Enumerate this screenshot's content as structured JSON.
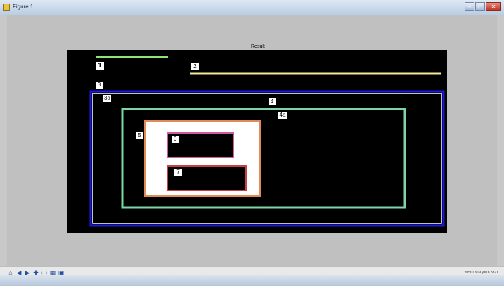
{
  "window": {
    "title": "Figure 1",
    "minimize_icon": "minimize-icon",
    "maximize_icon": "maximize-icon",
    "close_icon": "close-icon"
  },
  "figure": {
    "title": "Result",
    "labels": [
      "1",
      "2",
      "3",
      "3a",
      "4",
      "4a",
      "5",
      "6",
      "7"
    ]
  },
  "toolbar": {
    "icons": [
      "home-icon",
      "back-icon",
      "forward-icon",
      "pan-icon",
      "zoom-icon",
      "subplots-icon",
      "save-icon"
    ],
    "coordinates": "x=501.919   y=18.8371"
  },
  "colors": {
    "box_blue": "#1a1adc",
    "box_green": "#7ed6a8",
    "box_orange": "#e08a5a",
    "box_pink": "#d05aa0",
    "box_red": "#c84040",
    "line_green": "#8ee27a",
    "line_yellow": "#f3e79a"
  }
}
